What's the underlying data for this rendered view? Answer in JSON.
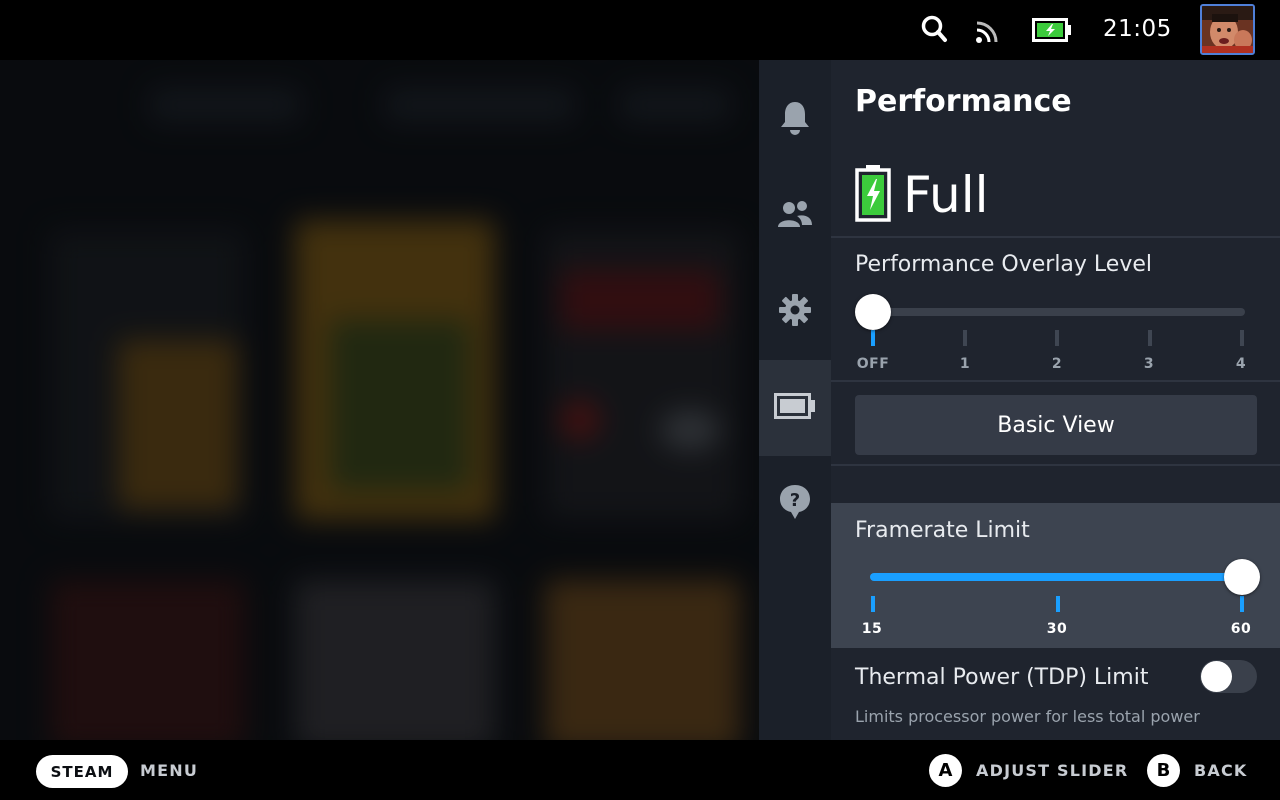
{
  "status_bar": {
    "clock": "21:05",
    "icons": [
      "search-icon",
      "wifi-icon",
      "battery-charging-icon",
      "avatar"
    ]
  },
  "rail": {
    "items": [
      {
        "name": "notifications",
        "icon": "bell-icon"
      },
      {
        "name": "friends",
        "icon": "friends-icon"
      },
      {
        "name": "settings",
        "icon": "gear-icon"
      },
      {
        "name": "performance",
        "icon": "battery-icon",
        "active": true
      },
      {
        "name": "help",
        "icon": "help-icon"
      }
    ]
  },
  "panel": {
    "title": "Performance",
    "profile_label": "Full",
    "overlay": {
      "label": "Performance Overlay Level",
      "ticks": [
        "OFF",
        "1",
        "2",
        "3",
        "4"
      ],
      "value_index": 0
    },
    "basic_view_label": "Basic View",
    "framerate": {
      "label": "Framerate Limit",
      "ticks": [
        "15",
        "30",
        "60"
      ],
      "value_index": 2
    },
    "tdp": {
      "label": "Thermal Power (TDP) Limit",
      "description": "Limits processor power for less total power",
      "enabled": false
    }
  },
  "bottom_bar": {
    "steam_label": "STEAM",
    "menu_label": "MENU",
    "a_button": "A",
    "a_label": "ADJUST SLIDER",
    "b_button": "B",
    "b_label": "BACK"
  },
  "colors": {
    "accent": "#1a9fff",
    "battery_green": "#3ccb3c",
    "panel_bg": "#1f242e",
    "highlight_bg": "#3d4450"
  }
}
